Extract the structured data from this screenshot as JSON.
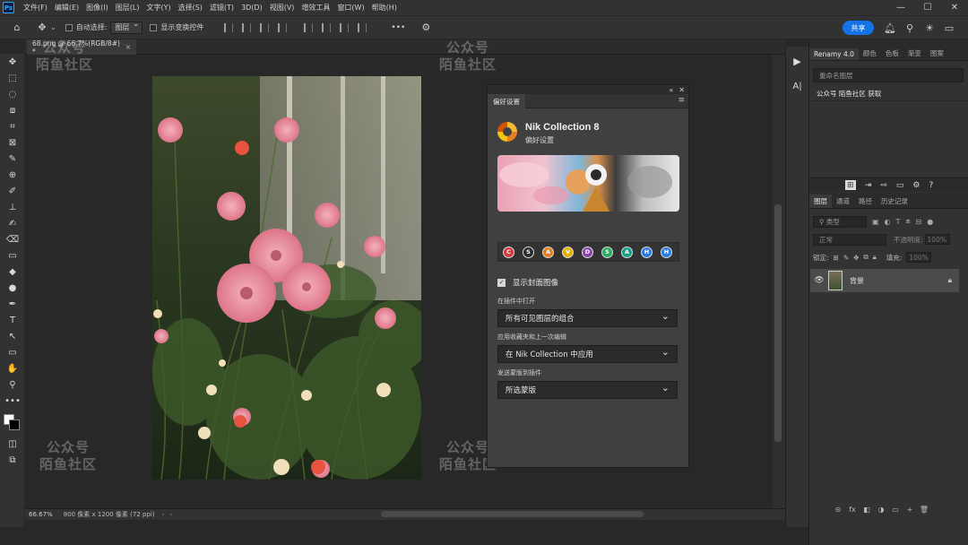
{
  "app": {
    "logo": "Ps"
  },
  "menu": [
    "文件(F)",
    "编辑(E)",
    "图像(I)",
    "图层(L)",
    "文字(Y)",
    "选择(S)",
    "滤镜(T)",
    "3D(D)",
    "视图(V)",
    "增效工具",
    "窗口(W)",
    "帮助(H)"
  ],
  "window_controls": {
    "minimize": "—",
    "maximize": "☐",
    "close": "✕"
  },
  "options": {
    "home_icon": "home-icon",
    "move_icon": "move-icon",
    "auto_select_label": "自动选择:",
    "auto_select_value": "图层",
    "show_transform_label": "显示变换控件",
    "more": "•••",
    "share": "共享"
  },
  "document_tab": {
    "title": "68.png @ 66.7%(RGB/8#) *",
    "close": "×"
  },
  "status": {
    "zoom": "66.67%",
    "info": "800 像素 x 1200 像素 (72 ppi)",
    "arrow_left": "‹",
    "arrow_right": "›"
  },
  "tools": [
    "✥",
    "⬚",
    "◌",
    "⧈",
    "⌗",
    "⊠",
    "✎",
    "⊕",
    "✐",
    "⊥",
    "✍",
    "⌫",
    "▭",
    "◆",
    "●",
    "✒",
    "T",
    "↖",
    "▭",
    "✋",
    "⚲",
    "•••"
  ],
  "iconstrip": {
    "play": "▶",
    "char": "A|"
  },
  "renamy": {
    "tabs": [
      "Renamy 4.0",
      "颜色",
      "色板",
      "渐变",
      "图案"
    ],
    "search_placeholder": "重命名图层",
    "item": "公众号 陌鱼社区 获取"
  },
  "layers_panel": {
    "tabs": [
      "图层",
      "通道",
      "路径",
      "历史记录"
    ],
    "kind_label": "类型",
    "blend_mode": "正常",
    "opacity_label": "不透明度:",
    "opacity_value": "100%",
    "lock_label": "锁定:",
    "fill_label": "填充:",
    "fill_value": "100%",
    "layer_name": "背景",
    "bottom_icons": [
      "⊝",
      "fx",
      "◧",
      "◑",
      "▭",
      "+",
      "🗑"
    ]
  },
  "dialog": {
    "tab": "偏好设置",
    "header_icons": [
      "«",
      "✕"
    ],
    "menu_icon": "≡",
    "product": "Nik Collection 8",
    "subtitle": "偏好设置",
    "plugins": [
      "C",
      "S",
      "A",
      "V",
      "D",
      "S",
      "A",
      "H",
      "H"
    ],
    "plugin_colors": [
      "#d63a3a",
      "#2b2b2b",
      "#e67e22",
      "#e2b100",
      "#8e44ad",
      "#27ae60",
      "#16a085",
      "#2c7be5",
      "#2c7be5"
    ],
    "show_cover_label": "显示封面图像",
    "show_cover_checked": "✓",
    "open_in_plugin_label": "在插件中打开",
    "open_in_plugin_value": "所有可见图层的组合",
    "apply_label": "应用收藏夹和上一次编辑",
    "apply_value": "在 Nik Collection 中应用",
    "send_mask_label": "发送蒙版到插件",
    "send_mask_value": "所选蒙版"
  },
  "watermark": {
    "line1": "公众号",
    "line2": "陌鱼社区"
  }
}
